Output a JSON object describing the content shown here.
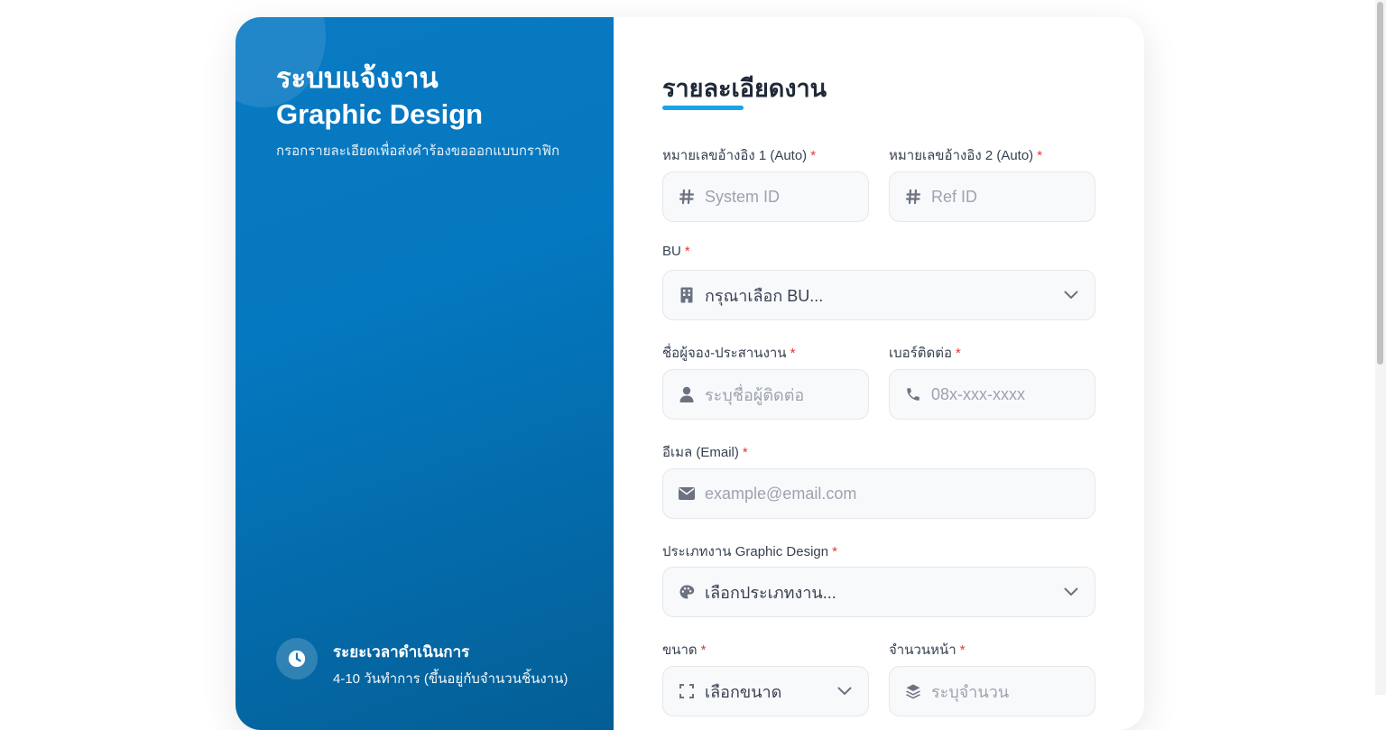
{
  "left": {
    "title_line1": "ระบบแจ้งงาน",
    "title_line2": "Graphic Design",
    "subtitle": "กรอกรายละเอียดเพื่อส่งคำร้องขอออกแบบกราฟิก",
    "duration_title": "ระยะเวลาดำเนินการ",
    "duration_detail": "4-10 วันทำการ (ขึ้นอยู่กับจำนวนชิ้นงาน)"
  },
  "form": {
    "title": "รายละเอียดงาน",
    "ref1": {
      "label": "หมายเลขอ้างอิง 1 (Auto)",
      "required": "*",
      "placeholder": "System ID",
      "icon": "hash-icon"
    },
    "ref2": {
      "label": "หมายเลขอ้างอิง 2 (Auto)",
      "required": "*",
      "placeholder": "Ref ID",
      "icon": "hash-icon"
    },
    "bu": {
      "label": "BU",
      "required": "*",
      "value": "กรุณาเลือก BU...",
      "icon": "building-icon"
    },
    "contact_name": {
      "label": "ชื่อผู้จอง-ประสานงาน",
      "required": "*",
      "placeholder": "ระบุชื่อผู้ติดต่อ",
      "icon": "user-icon"
    },
    "phone": {
      "label": "เบอร์ติดต่อ",
      "required": "*",
      "placeholder": "08x-xxx-xxxx",
      "icon": "phone-icon"
    },
    "email": {
      "label": "อีเมล (Email)",
      "required": "*",
      "placeholder": "example@email.com",
      "icon": "envelope-icon"
    },
    "job_type": {
      "label": "ประเภทงาน Graphic Design",
      "required": "*",
      "value": "เลือกประเภทงาน...",
      "icon": "palette-icon"
    },
    "size": {
      "label": "ขนาด",
      "required": "*",
      "value": "เลือกขนาด",
      "icon": "expand-icon"
    },
    "pages": {
      "label": "จำนวนหน้า",
      "required": "*",
      "placeholder": "ระบุจำนวน",
      "icon": "layers-icon"
    }
  },
  "colors": {
    "accent": "#1aa3e8",
    "panel": "#0478c0",
    "required": "#e53935"
  }
}
